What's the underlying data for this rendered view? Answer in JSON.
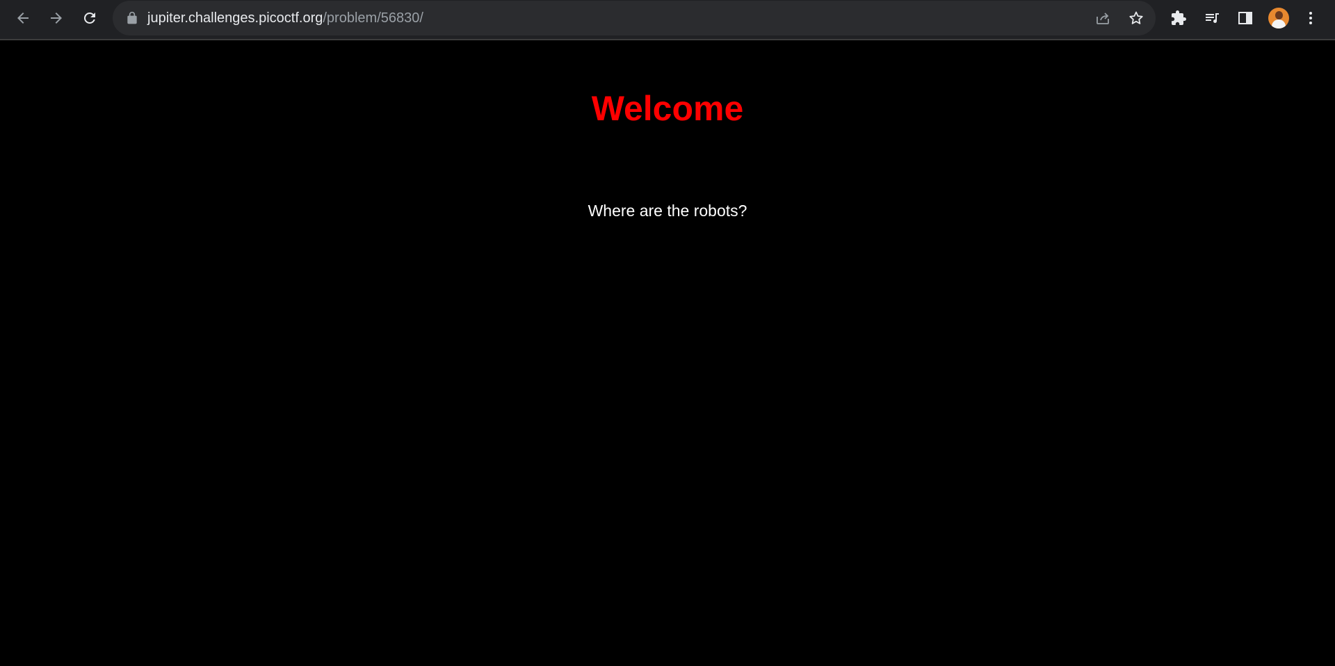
{
  "browser": {
    "url_host": "jupiter.challenges.picoctf.org",
    "url_path": "/problem/56830/",
    "icons": {
      "back": "arrow-left",
      "forward": "arrow-right",
      "reload": "reload",
      "lock": "lock",
      "share": "share",
      "bookmark": "star",
      "extensions": "puzzle-piece",
      "media": "playlist-music",
      "side_panel": "side-panel",
      "profile": "avatar",
      "menu": "three-dots-vertical"
    },
    "colors": {
      "toolbar_bg": "#202124",
      "omnibox_bg": "#2b2c2f",
      "icon": "#e8eaed",
      "icon_dim": "#9aa0a6"
    }
  },
  "page": {
    "heading": "Welcome",
    "subtext": "Where are the robots?",
    "colors": {
      "background": "#000000",
      "heading": "#ff0000",
      "text": "#ffffff"
    }
  }
}
